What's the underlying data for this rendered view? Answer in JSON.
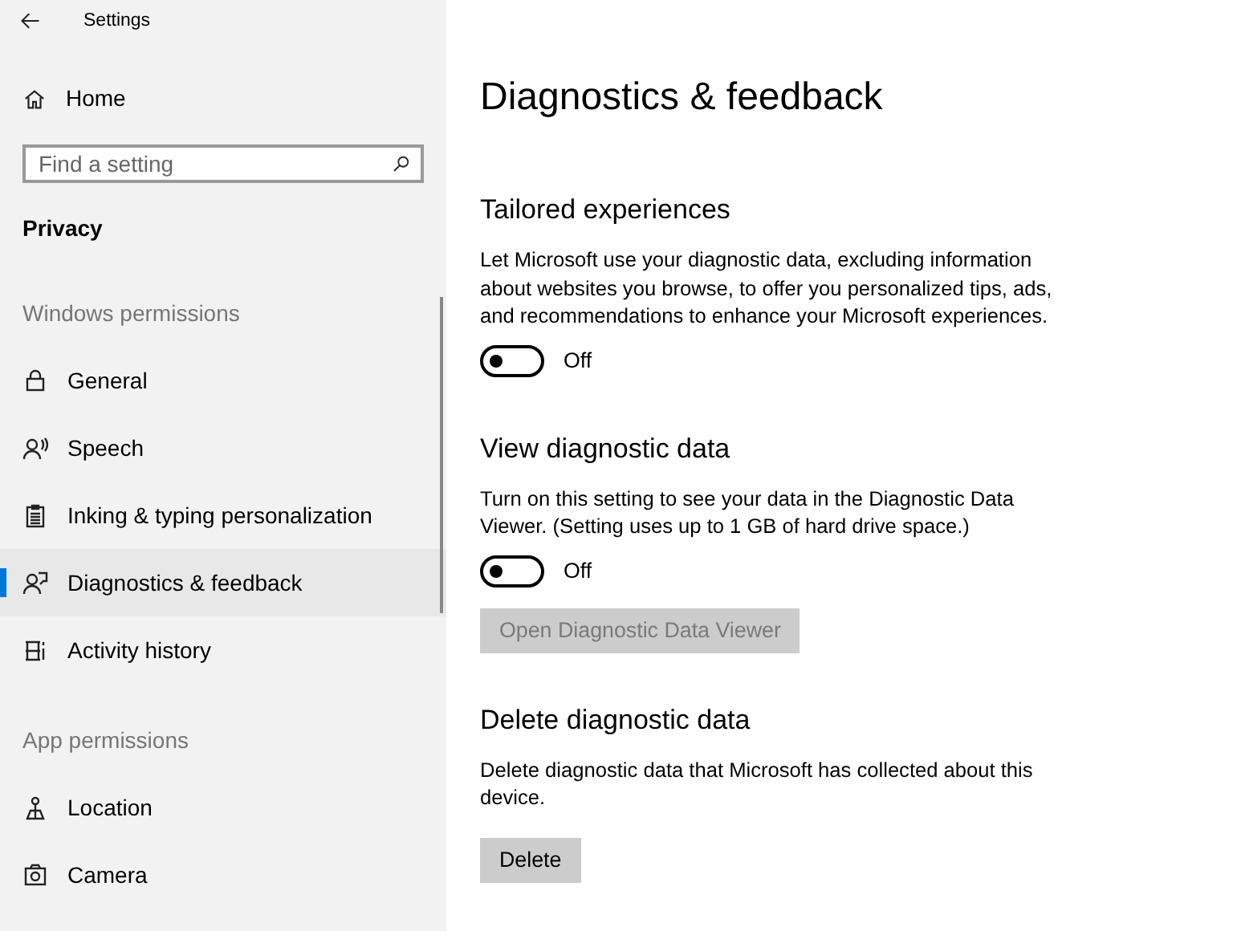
{
  "window": {
    "title": "Settings"
  },
  "sidebar": {
    "home": "Home",
    "search": {
      "placeholder": "Find a setting"
    },
    "section": "Privacy",
    "groups": [
      {
        "header": "Windows permissions",
        "items": [
          {
            "label": "General",
            "selected": false
          },
          {
            "label": "Speech",
            "selected": false
          },
          {
            "label": "Inking & typing personalization",
            "selected": false
          },
          {
            "label": "Diagnostics & feedback",
            "selected": true
          },
          {
            "label": "Activity history",
            "selected": false
          }
        ]
      },
      {
        "header": "App permissions",
        "items": [
          {
            "label": "Location",
            "selected": false
          },
          {
            "label": "Camera",
            "selected": false
          }
        ]
      }
    ]
  },
  "main": {
    "title": "Diagnostics & feedback",
    "sections": [
      {
        "heading": "Tailored experiences",
        "description": "Let Microsoft use your diagnostic data, excluding information about websites you browse, to offer you personalized tips, ads, and recommendations to enhance your Microsoft experiences.",
        "controls": [
          {
            "kind": "toggle",
            "on": false,
            "label": "Off"
          }
        ]
      },
      {
        "heading": "View diagnostic data",
        "description": "Turn on this setting to see your data in the Diagnostic Data Viewer. (Setting uses up to 1 GB of hard drive space.)",
        "controls": [
          {
            "kind": "toggle",
            "on": false,
            "label": "Off"
          },
          {
            "kind": "button",
            "label": "Open Diagnostic Data Viewer",
            "disabled": true
          }
        ]
      },
      {
        "heading": "Delete diagnostic data",
        "description": "Delete diagnostic data that Microsoft has collected about this device.",
        "controls": [
          {
            "kind": "button",
            "label": "Delete",
            "disabled": false
          }
        ]
      }
    ]
  }
}
